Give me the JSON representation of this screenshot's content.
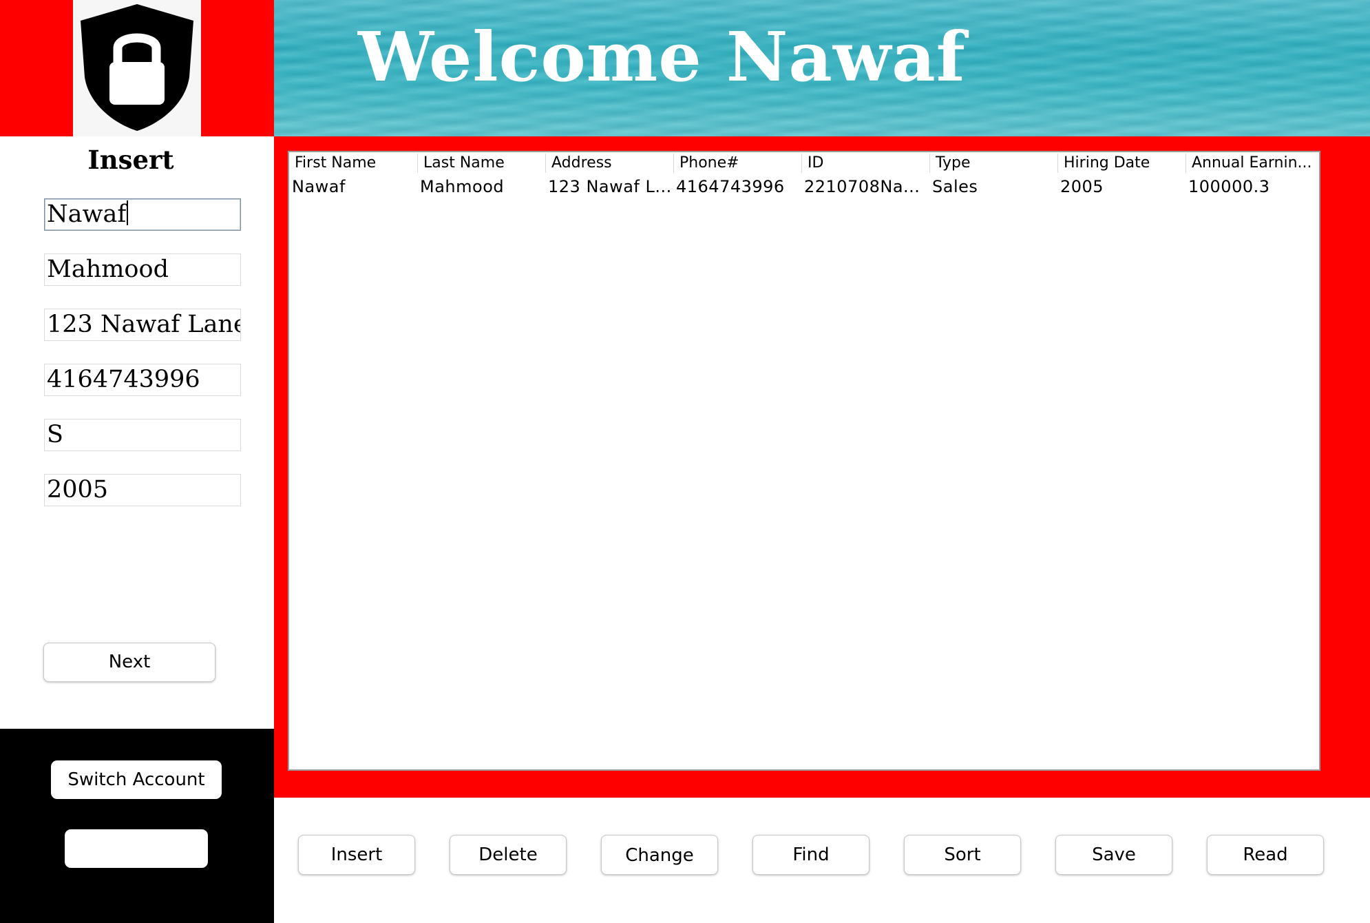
{
  "logo": {
    "icon": "shield-lock-icon"
  },
  "header": {
    "title": "Welcome Nawaf"
  },
  "left_panel": {
    "heading": "Insert",
    "fields": [
      {
        "value": "Nawaf"
      },
      {
        "value": "Mahmood"
      },
      {
        "value": "123 Nawaf Lane"
      },
      {
        "value": "4164743996"
      },
      {
        "value": "S"
      },
      {
        "value": "2005"
      }
    ],
    "next_label": "Next"
  },
  "account": {
    "switch_label": "Switch Account",
    "blank_label": ""
  },
  "table": {
    "columns": [
      "First Name",
      "Last Name",
      "Address",
      "Phone#",
      "ID",
      "Type",
      "Hiring Date",
      "Annual Earnin..."
    ],
    "rows": [
      [
        "Nawaf",
        "Mahmood",
        "123 Nawaf L...",
        "4164743996",
        "2210708Na...",
        "Sales",
        "2005",
        "100000.3"
      ]
    ]
  },
  "actions": [
    "Insert",
    "Delete",
    "Change",
    "Find",
    "Sort",
    "Save",
    "Read"
  ],
  "colors": {
    "accent": "#ff0000",
    "sidebar_bottom": "#000000",
    "header_water": "#3ab7c5"
  }
}
